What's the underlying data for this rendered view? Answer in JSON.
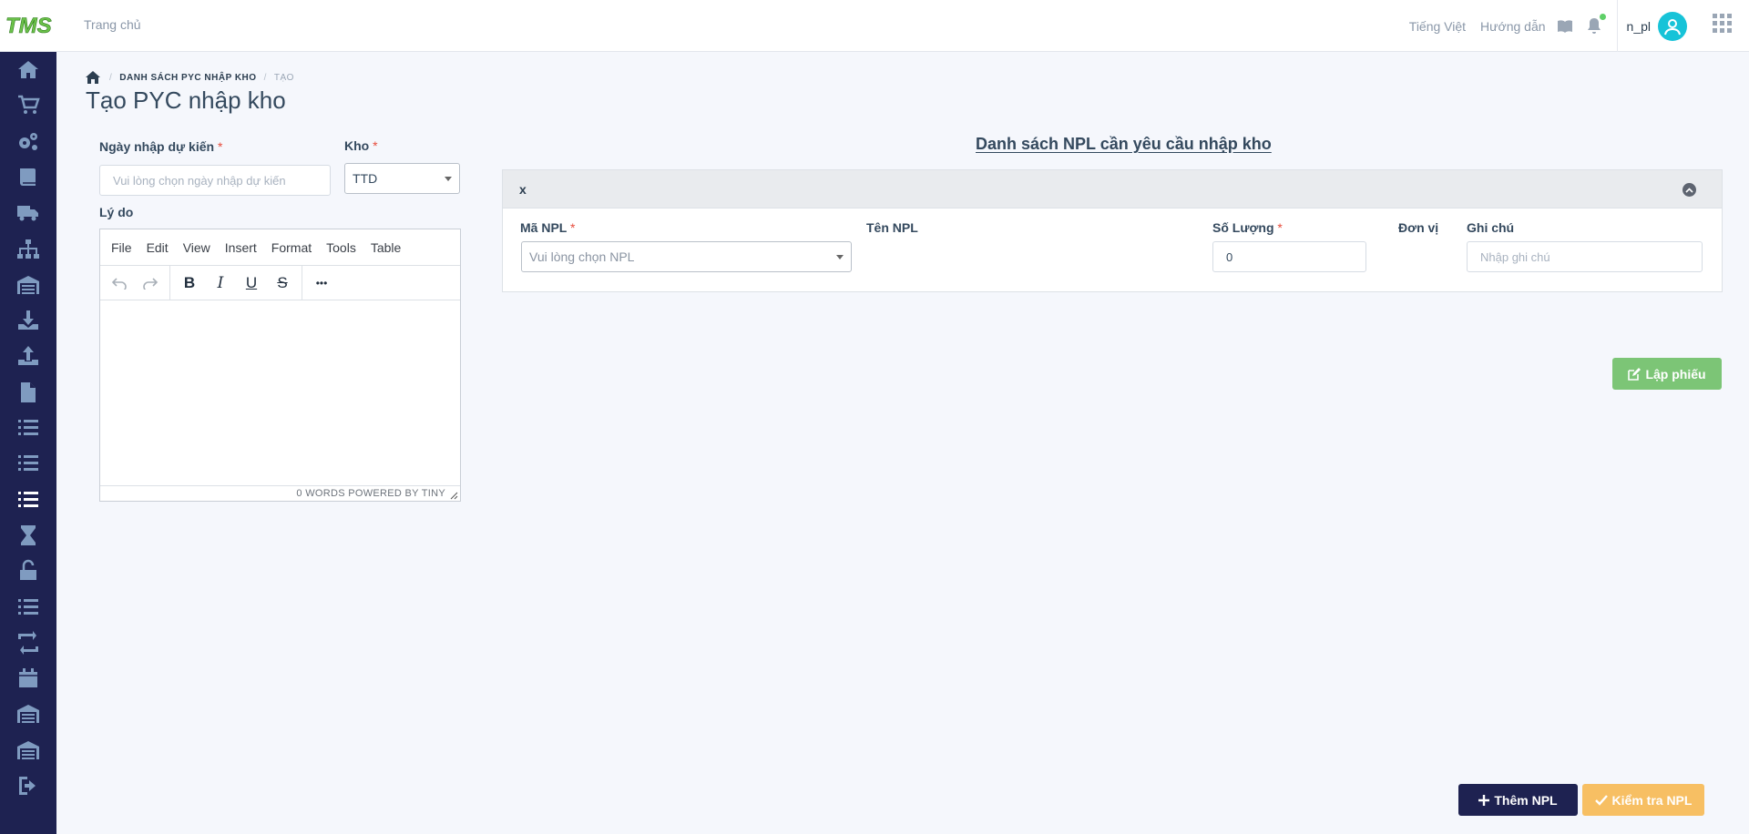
{
  "header": {
    "logo_text": "TMS",
    "home_link": "Trang chủ",
    "language": "Tiếng Việt",
    "guide": "Hướng dẫn",
    "username": "n_pl",
    "icons": [
      "book-icon",
      "bell-icon",
      "user-avatar-icon",
      "apps-grid-icon"
    ]
  },
  "sidebar": {
    "items": [
      {
        "icon": "home-icon"
      },
      {
        "icon": "cart-icon"
      },
      {
        "icon": "gears-icon"
      },
      {
        "icon": "book-icon"
      },
      {
        "icon": "truck-icon"
      },
      {
        "icon": "sitemap-icon"
      },
      {
        "icon": "warehouse-icon"
      },
      {
        "icon": "download-icon"
      },
      {
        "icon": "upload-icon"
      },
      {
        "icon": "file-icon"
      },
      {
        "icon": "list-icon"
      },
      {
        "icon": "list-icon"
      },
      {
        "icon": "list-icon",
        "active": true
      },
      {
        "icon": "hourglass-icon"
      },
      {
        "icon": "unlock-icon"
      },
      {
        "icon": "list-icon"
      },
      {
        "icon": "retweet-icon"
      },
      {
        "icon": "calendar-icon"
      },
      {
        "icon": "warehouse-icon"
      },
      {
        "icon": "warehouse-icon"
      },
      {
        "icon": "sign-out-icon"
      }
    ]
  },
  "breadcrumb": {
    "parent": "DANH SÁCH PYC NHẬP KHO",
    "current": "TẠO"
  },
  "page_title": "Tạo PYC nhập kho",
  "form": {
    "date_label": "Ngày nhập dự kiến",
    "date_placeholder": "Vui lòng chọn ngày nhập dự kiến",
    "warehouse_label": "Kho",
    "warehouse_value": "TTD",
    "reason_label": "Lý do",
    "required_mark": "*"
  },
  "editor": {
    "menu": [
      "File",
      "Edit",
      "View",
      "Insert",
      "Format",
      "Tools",
      "Table"
    ],
    "toolbar_icons": [
      "undo-icon",
      "redo-icon",
      "bold-icon",
      "italic-icon",
      "underline-icon",
      "strikethrough-icon",
      "more-icon"
    ],
    "bold_glyph": "B",
    "italic_glyph": "I",
    "underline_glyph": "U",
    "strike_glyph": "S",
    "more_glyph": "•••",
    "status": "0 WORDS  POWERED BY TINY"
  },
  "npl_section": {
    "title": "Danh sách NPL cần yêu cầu nhập kho",
    "card_title": "x",
    "columns": {
      "code": "Mã NPL",
      "name": "Tên NPL",
      "quantity": "Số Lượng",
      "unit": "Đơn vị",
      "note": "Ghi chú"
    },
    "code_placeholder": "Vui lòng chọn NPL",
    "quantity_value": "0",
    "note_placeholder": "Nhập ghi chú"
  },
  "buttons": {
    "create": "Lập phiếu",
    "add": "Thêm NPL",
    "check": "Kiểm tra NPL"
  },
  "colors": {
    "sidebar": "#1e2251",
    "green": "#7cc576",
    "orange": "#f7bf63",
    "navy": "#1e2251",
    "required": "#e74c3c"
  }
}
